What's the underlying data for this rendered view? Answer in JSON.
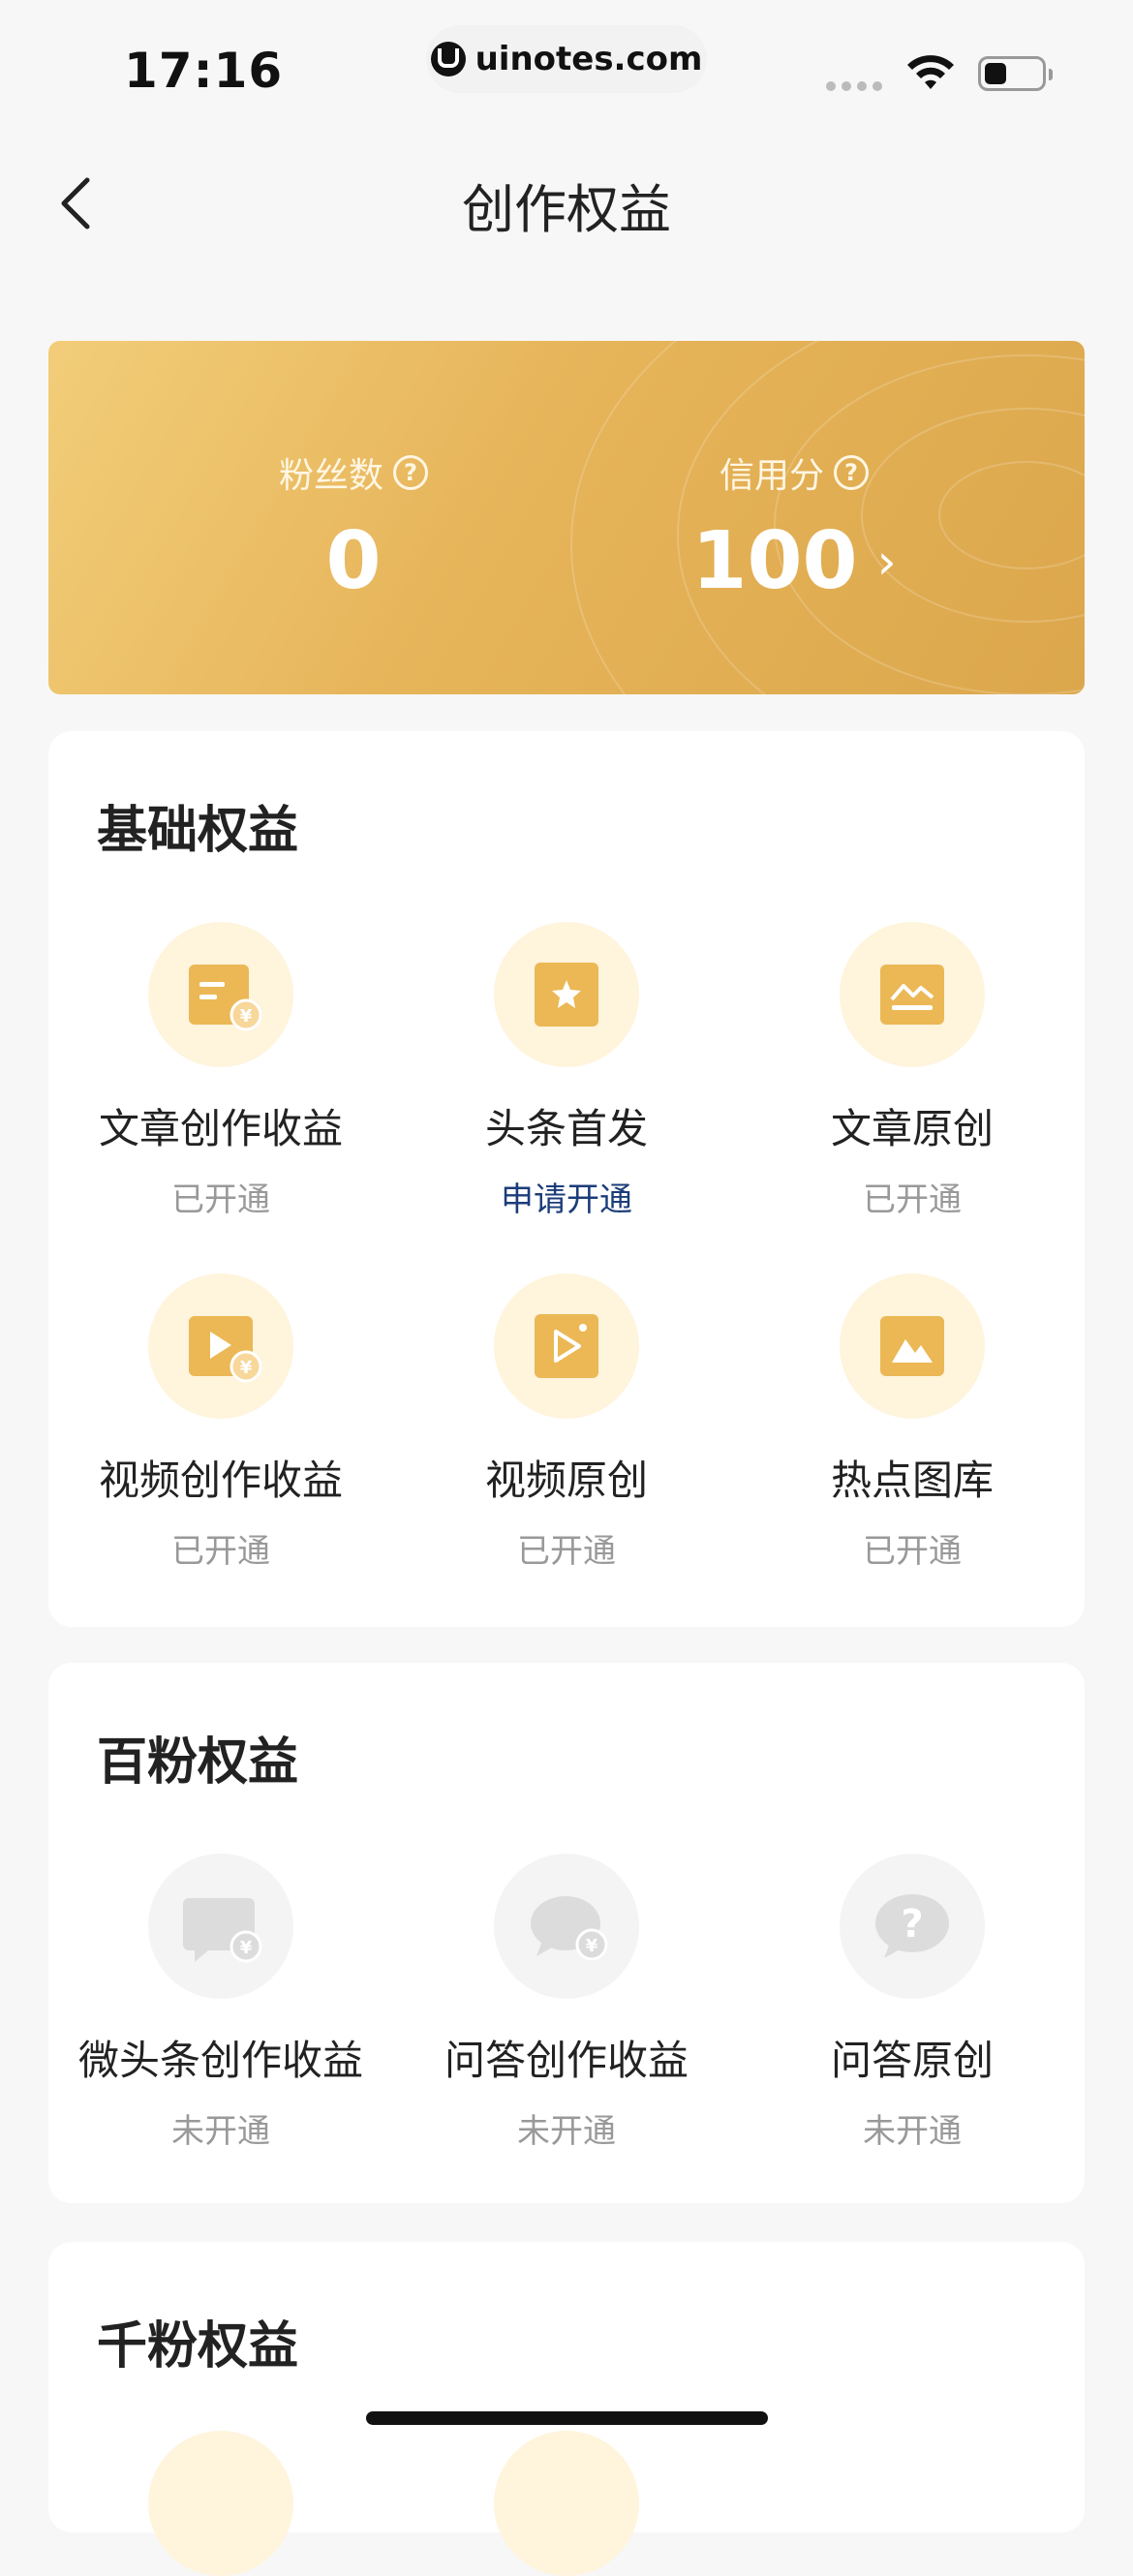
{
  "status_bar": {
    "time": "17:16",
    "url": "uinotes.com"
  },
  "nav": {
    "title": "创作权益"
  },
  "stats": {
    "fans": {
      "label": "粉丝数",
      "value": "0"
    },
    "credit": {
      "label": "信用分",
      "value": "100"
    }
  },
  "sections": [
    {
      "title": "基础权益",
      "items": [
        {
          "label": "文章创作收益",
          "status": "已开通",
          "icon": "article-income-icon"
        },
        {
          "label": "头条首发",
          "status": "申请开通",
          "icon": "star-doc-icon"
        },
        {
          "label": "文章原创",
          "status": "已开通",
          "icon": "article-original-icon"
        },
        {
          "label": "视频创作收益",
          "status": "已开通",
          "icon": "video-income-icon"
        },
        {
          "label": "视频原创",
          "status": "已开通",
          "icon": "video-original-icon"
        },
        {
          "label": "热点图库",
          "status": "已开通",
          "icon": "image-library-icon"
        }
      ]
    },
    {
      "title": "百粉权益",
      "items": [
        {
          "label": "微头条创作收益",
          "status": "未开通",
          "icon": "micro-toutiao-income-icon"
        },
        {
          "label": "问答创作收益",
          "status": "未开通",
          "icon": "qa-income-icon"
        },
        {
          "label": "问答原创",
          "status": "未开通",
          "icon": "qa-original-icon"
        }
      ]
    },
    {
      "title": "千粉权益"
    }
  ],
  "colors": {
    "gold": "#e6b459",
    "apply_link": "#1c3d7a",
    "inactive_text": "#999999"
  }
}
